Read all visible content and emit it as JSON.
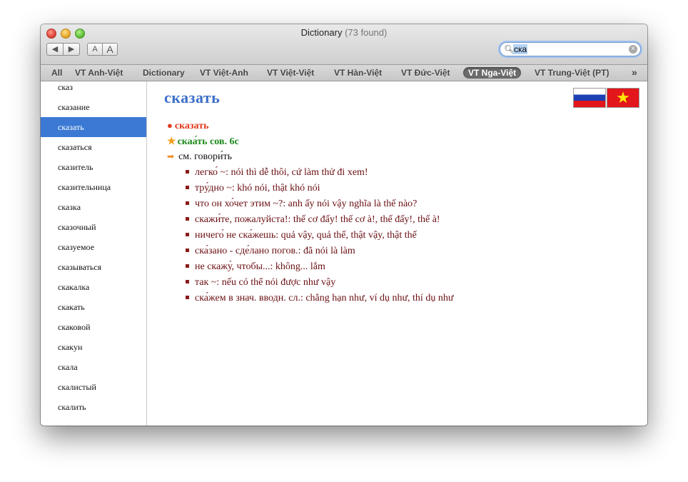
{
  "window": {
    "title": "Dictionary",
    "count": "(73 found)"
  },
  "toolbar": {
    "back_label": "◀",
    "forward_label": "▶",
    "font_small_label": "A",
    "font_large_label": "A"
  },
  "search": {
    "value": "ска",
    "icon": "magnifier-icon"
  },
  "tabs": [
    {
      "label": "All"
    },
    {
      "label": "VT Anh-Việt"
    },
    {
      "label": "Dictionary"
    },
    {
      "label": "VT Việt-Anh"
    },
    {
      "label": "VT Việt-Việt"
    },
    {
      "label": "VT Hàn-Việt"
    },
    {
      "label": "VT Đức-Việt"
    },
    {
      "label": "VT Nga-Việt",
      "active": true
    },
    {
      "label": "VT Trung-Việt (PT)"
    }
  ],
  "tabs_overflow": "»",
  "sidebar": {
    "selected_index": 2,
    "items": [
      "сказ",
      "сказание",
      "сказать",
      "сказаться",
      "сказитель",
      "сказительница",
      "сказка",
      "сказочный",
      "сказуемое",
      "сказываться",
      "скакалка",
      "скакать",
      "скаковой",
      "скакун",
      "скала",
      "скалистый",
      "скалить"
    ]
  },
  "entry": {
    "headword": "сказать",
    "flags": [
      "russia-flag-icon",
      "vietnam-flag-icon"
    ],
    "line1": "сказать",
    "line2": "скаа́ть  сов.  6с",
    "line3": "см.  говори́ть",
    "senses": [
      "легко́ ~: nói thì dễ thôi, cứ làm thử đi xem!",
      "тру́дно ~: khó nói, thật khó nói",
      "что он хо́чет этим ~?: anh ấy nói vậy nghĩa là thế nào?",
      "скажи́те, пожалуйста!: thế cơ đấy! thế cơ à!, thế đấy!, thế à!",
      "ничего́ не ска́жешь: quả vậy, quả thế, thật vậy, thật thế",
      "ска́зано - сде́лано  погов.: đã nói là làm",
      "не скажу́, чтобы...: không... lắm",
      "так ~: nếu có thể nói được như vậy",
      "ска́жем  в знач. вводн. сл.: chẳng hạn như, ví dụ như, thí dụ như"
    ]
  },
  "colors": {
    "headword": "#3a6fc9",
    "selection": "#3b79d4",
    "sense_text": "#6a0e12",
    "line1": "#e23a1d",
    "line2": "#1d8a1d"
  }
}
